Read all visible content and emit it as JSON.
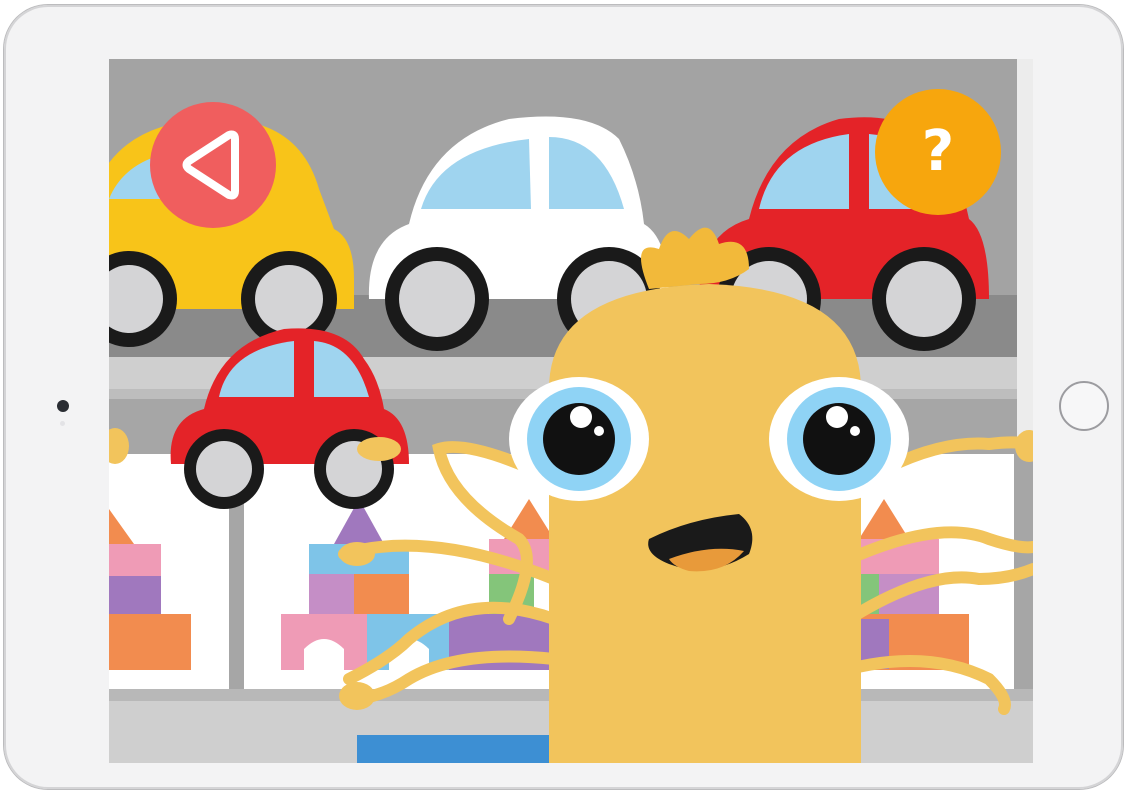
{
  "device": {
    "frame_color": "#f3f3f4",
    "home_button": "home-button"
  },
  "toolbar": {
    "back_button": {
      "icon": "play-left-triangle-icon",
      "color": "#f05e5e"
    },
    "help_button": {
      "icon": "question-mark-icon",
      "label": "?",
      "color": "#f7a60d"
    }
  },
  "scene": {
    "character": "yellow-octopus-monster",
    "shelf_top_items": [
      "yellow-car",
      "white-car",
      "red-car"
    ],
    "held_item": "red-toy-car",
    "shelf_bottom_items": [
      "block-castle",
      "block-castle",
      "block-castle"
    ],
    "colors": {
      "monster": "#f2c45c",
      "shelf": "#c4c4c4",
      "wall": "#a6a6a6",
      "red": "#e42328",
      "yellow": "#f8c419"
    }
  }
}
